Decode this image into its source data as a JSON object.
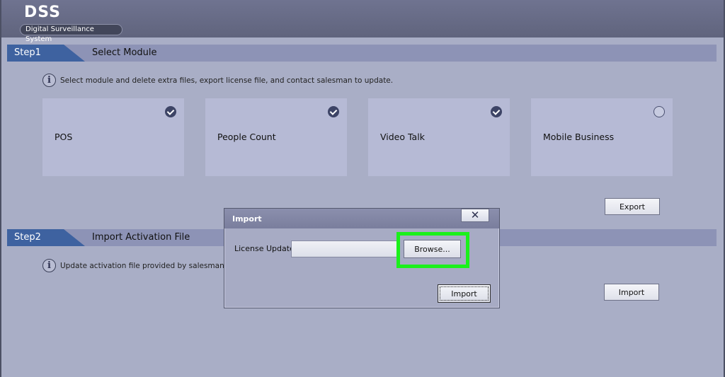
{
  "app": {
    "logo": "DSS",
    "subtitle": "Digital Surveillance System"
  },
  "step1": {
    "tag": "Step1",
    "title": "Select Module",
    "info": "Select module and delete extra files, export license file, and contact salesman to update.",
    "modules": [
      {
        "label": "POS",
        "checked": true
      },
      {
        "label": "People Count",
        "checked": true
      },
      {
        "label": "Video Talk",
        "checked": true
      },
      {
        "label": "Mobile Business",
        "checked": false
      }
    ],
    "export_label": "Export"
  },
  "step2": {
    "tag": "Step2",
    "title": "Import Activation File",
    "info": "Update activation file provided by salesman (su",
    "import_label": "Import"
  },
  "dialog": {
    "title": "Import",
    "close_glyph": "✕",
    "license_label": "License Update :",
    "license_value": "",
    "browse_label": "Browse...",
    "import_label": "Import"
  },
  "colors": {
    "background": "#a9aec6",
    "step_accent": "#3e62a0",
    "highlight": "#1bf01b"
  }
}
